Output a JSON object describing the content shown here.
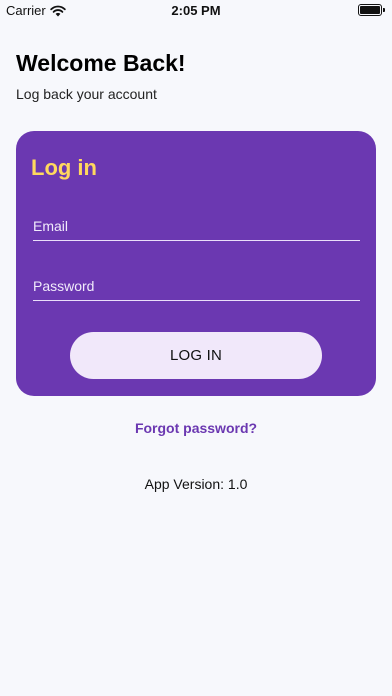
{
  "status_bar": {
    "carrier": "Carrier",
    "time": "2:05 PM",
    "battery_level": 1.0
  },
  "header": {
    "title": "Welcome Back!",
    "subtitle": "Log back your account"
  },
  "login_card": {
    "title": "Log in",
    "email_placeholder": "Email",
    "email_value": "",
    "password_placeholder": "Password",
    "password_value": "",
    "button_label": "LOG IN"
  },
  "forgot_password": "Forgot password?",
  "version": {
    "label": "App Version: ",
    "value": "1.0"
  },
  "colors": {
    "card_background": "#6b38b1",
    "card_title": "#ffd85e",
    "button_background": "#f1e8fa",
    "link": "#6b38b1",
    "page_background": "#f7f8fc"
  },
  "icons": [
    "wifi-icon",
    "battery-icon"
  ]
}
